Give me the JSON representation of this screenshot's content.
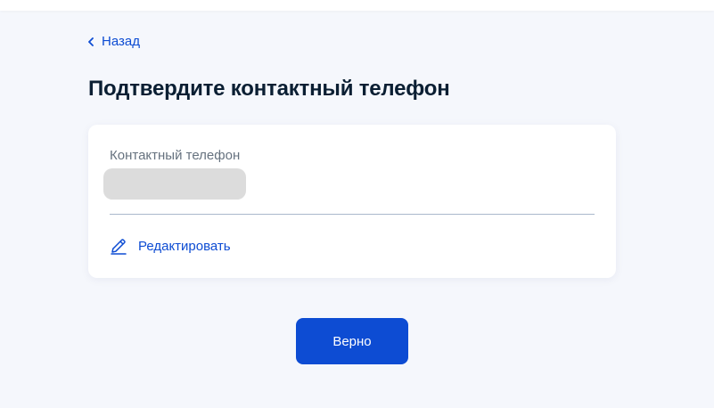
{
  "nav": {
    "back_label": "Назад",
    "back_icon": "chevron-left-icon"
  },
  "page": {
    "title": "Подтвердите контактный телефон"
  },
  "contact_card": {
    "field_label": "Контактный телефон",
    "edit_label": "Редактировать",
    "edit_icon": "pencil-icon"
  },
  "actions": {
    "confirm_label": "Верно"
  },
  "colors": {
    "accent": "#0d4cd3",
    "background": "#f5f7fc",
    "card": "#ffffff",
    "title_text": "#0b1f33",
    "label_text": "#66727f",
    "divider": "#aab9cc",
    "masked_value": "#dcdcdc"
  }
}
